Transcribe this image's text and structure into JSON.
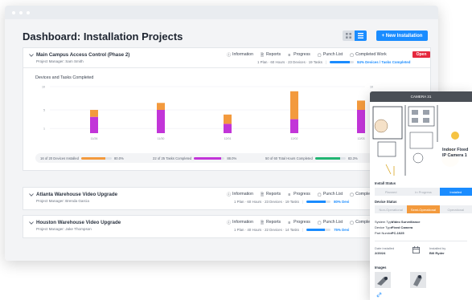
{
  "page": {
    "title": "Dashboard: Installation Projects",
    "new_button": "+ New Installation"
  },
  "colors": {
    "accent": "#1a8cff",
    "orange": "#f39a3d",
    "magenta": "#c235d8",
    "green": "#22b573",
    "open": "#e5283e"
  },
  "links": {
    "information": "Information",
    "reports": "Reports",
    "progress": "Progress",
    "punch_list": "Punch List",
    "completed": "Completed Work",
    "completed_short": "Complet"
  },
  "projects": [
    {
      "name": "Main Campus Access Control (Phase 2)",
      "manager": "Project Manager: Sam Smith",
      "meta": "1 Plan  ·  60 Hours  ·  23 Devices  ·  19 Tasks",
      "progress": 0.84,
      "pct_label": "84% Devices / Tasks Completed",
      "badge": "Open"
    },
    {
      "name": "Atlanta Warehouse Video Upgrade",
      "manager": "Project Manager: Brenda Garcia",
      "meta": "1 Plan  ·  60 Hours  ·  23 Devices  ·  19 Tasks",
      "progress": 0.8,
      "pct_label": "80% Devi"
    },
    {
      "name": "Houston Warehouse Video Upgrade",
      "manager": "Project Manager: Jake Thompson",
      "meta": "1 Plan  ·  40 Hours  ·  22 Devices  ·  14 Tasks",
      "progress": 0.75,
      "pct_label": "75% Devi"
    }
  ],
  "chart_data": {
    "type": "bar",
    "title": "Devices and Tasks Completed",
    "categories": [
      "11/26",
      "11/30",
      "12/01",
      "12/02",
      "12/03"
    ],
    "series": [
      {
        "name": "",
        "color": "#c235d8",
        "values": [
          3.5,
          5,
          2,
          3,
          5
        ]
      },
      {
        "name": "",
        "color": "#f39a3d",
        "values": [
          1.5,
          1.5,
          2,
          6,
          2
        ]
      }
    ],
    "yticks": [
      "10",
      "5",
      "1"
    ]
  },
  "stats": [
    {
      "label": "16 of 20 Devices Installed",
      "value": 0.8,
      "pct": "80.0%",
      "color": "#f39a3d"
    },
    {
      "label": "22 of 25 Tasks Completed",
      "value": 0.88,
      "pct": "88.0%",
      "color": "#c235d8"
    },
    {
      "label": "50 of 60 Total Hours Completed",
      "value": 0.833,
      "pct": "83.3%",
      "color": "#22b573"
    }
  ],
  "camera": {
    "title": "CAMERA 31",
    "map_label_1": "Indoor Fixed",
    "map_label_2": "IP Camera 1",
    "install_status_label": "Install Status",
    "install_status": [
      "Planned",
      "In Progress",
      "Installed"
    ],
    "device_status_label": "Device Status",
    "device_status": [
      "Non-Operational",
      "Semi-Operational",
      "Operational"
    ],
    "system_type_label": "System Type",
    "system_type": "Video Surveillance",
    "device_type_label": "Device Type",
    "device_type": "Fixed Camera",
    "part_number_label": "Part Number",
    "part_number": "FC-1025",
    "date_installed_label": "Date installed",
    "date_installed": "2/20/24",
    "installed_by_label": "Installed by",
    "installed_by": "Bill Ryder",
    "images_label": "Images"
  }
}
